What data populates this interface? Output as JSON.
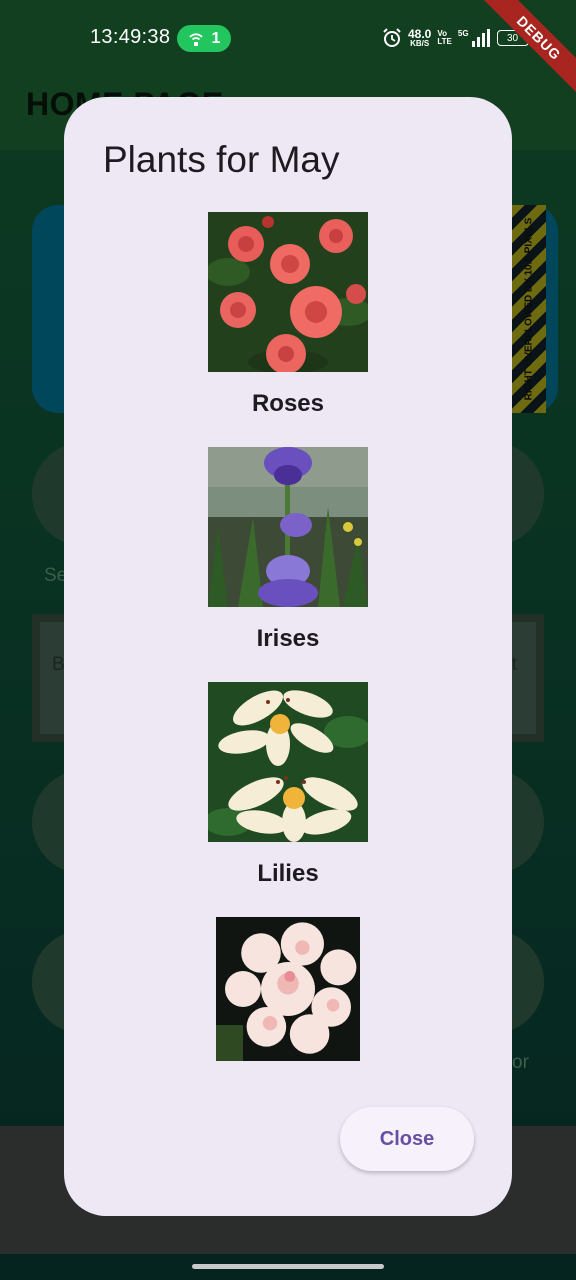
{
  "status_bar": {
    "time": "13:49:38",
    "hotspot_count": "1",
    "net_speed": "48.0",
    "net_speed_unit": "KB/S",
    "volte_top": "Vo",
    "volte_bottom": "LTE",
    "network": "5G",
    "battery": "30"
  },
  "debug_banner": "DEBUG",
  "background": {
    "app_title": "HOME PAGE",
    "overflow_warning": "RIGHT OVERFLOWED BY 10.0 PIXELS",
    "text_a": "Se",
    "text_b": "B",
    "text_c": "ct",
    "text_d": "or"
  },
  "dialog": {
    "title": "Plants for May",
    "plants": [
      {
        "name": "Roses"
      },
      {
        "name": "Irises"
      },
      {
        "name": "Lilies"
      },
      {
        "name": ""
      }
    ],
    "close_label": "Close"
  },
  "colors": {
    "dialog_bg": "#eee7f4",
    "accent": "#6750a4",
    "hotspot": "#22c55e",
    "debug": "#a8261f"
  }
}
